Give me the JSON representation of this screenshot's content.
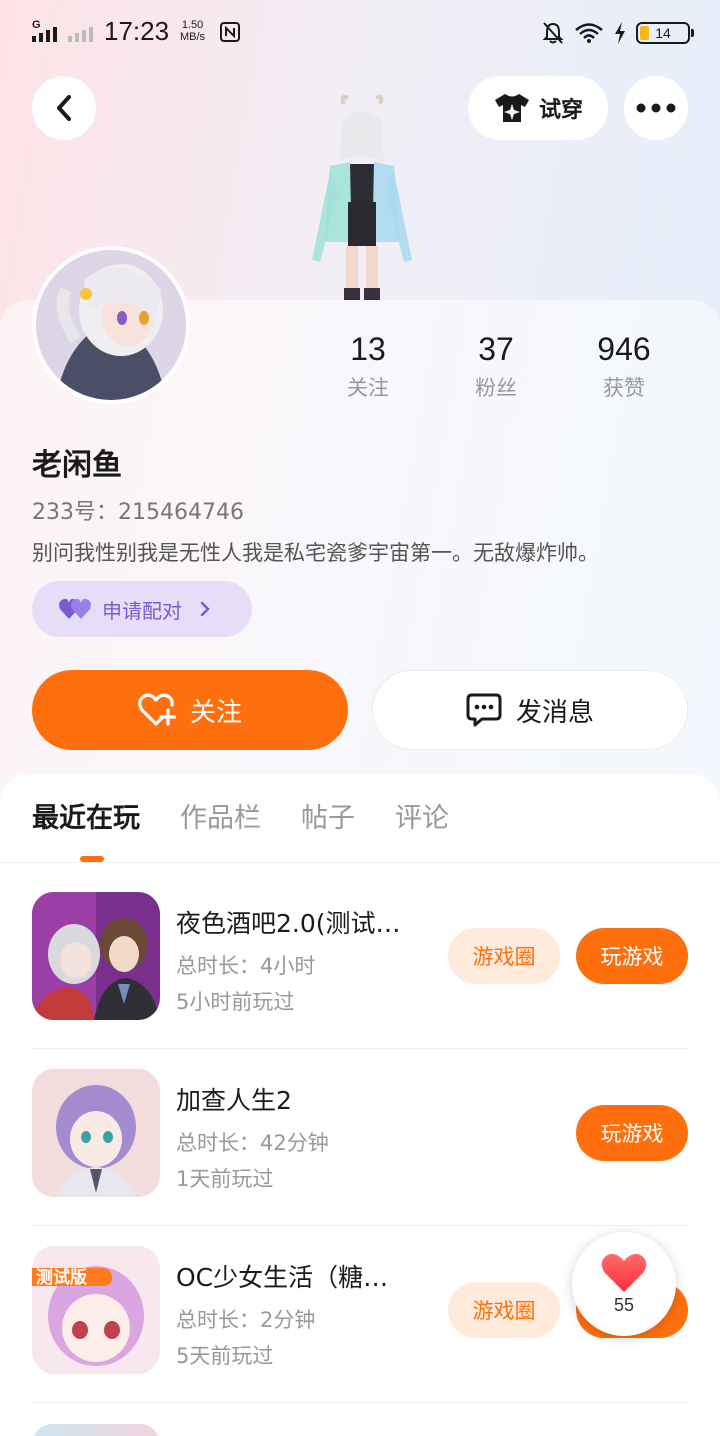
{
  "status_bar": {
    "network_label": "G",
    "time": "17:23",
    "speed_value": "1.50",
    "speed_unit": "MB/s",
    "battery": "14"
  },
  "top_bar": {
    "back_icon": "chevron-left-icon",
    "tryon_label": "试穿",
    "more_icon": "more-dots-icon"
  },
  "profile": {
    "stats": [
      {
        "value": "13",
        "label": "关注"
      },
      {
        "value": "37",
        "label": "粉丝"
      },
      {
        "value": "946",
        "label": "获赞"
      }
    ],
    "name": "老闲鱼",
    "uid": "233号：215464746",
    "bio": "别问我性别我是无性人我是私宅瓷爹宇宙第一。无敌爆炸帅。",
    "pair_label": "申请配对",
    "follow_label": "关注",
    "message_label": "发消息"
  },
  "tabs": [
    "最近在玩",
    "作品栏",
    "帖子",
    "评论"
  ],
  "games": [
    {
      "title": "夜色酒吧2.0(测试…",
      "duration": "总时长：4小时",
      "last_played": "5小时前玩过",
      "circle_label": "游戏圈",
      "play_label": "玩游戏"
    },
    {
      "title": "加查人生2",
      "duration": "总时长：42分钟",
      "last_played": "1天前玩过",
      "play_label": "玩游戏"
    },
    {
      "title": "OC少女生活（糖…",
      "duration": "总时长：2分钟",
      "last_played": "5天前玩过",
      "circle_label": "游戏圈",
      "badge": "测试版"
    }
  ],
  "like_fab": {
    "count": "55"
  },
  "colors": {
    "accent": "#ff6f0e",
    "accent_light": "#ffeadb",
    "pair_bg": "#e6ddf7",
    "pair_text": "#7b5bd3"
  }
}
